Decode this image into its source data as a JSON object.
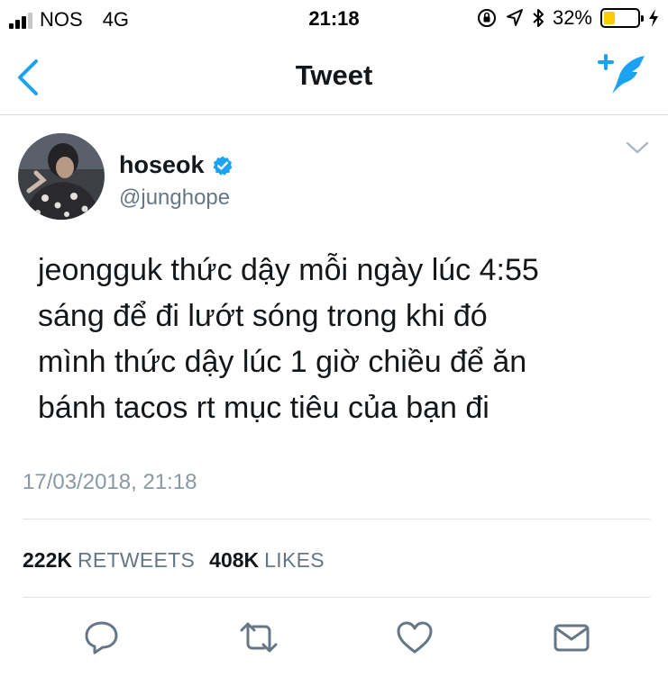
{
  "status_bar": {
    "carrier": "NOS",
    "network": "4G",
    "time": "21:18",
    "battery_percent": "32%",
    "battery_level": 0.32,
    "signal_bars_filled": 3,
    "signal_bars_total": 4,
    "icons": [
      "orientation-lock-icon",
      "location-arrow-icon",
      "bluetooth-icon",
      "battery-icon",
      "charging-bolt-icon"
    ]
  },
  "nav": {
    "title": "Tweet",
    "back_icon": "chevron-left-icon",
    "compose_icon": "compose-tweet-icon"
  },
  "tweet": {
    "display_name": "hoseok",
    "verified": true,
    "handle": "@junghope",
    "lines": [
      "jeongguk thức dậy mỗi ngày lúc 4:55",
      "sáng để đi lướt sóng trong khi đó",
      "mình thức dậy lúc 1 giờ chiều để ăn",
      "bánh tacos rt mục tiêu của bạn đi"
    ],
    "timestamp": "17/03/2018, 21:18"
  },
  "stats": {
    "retweets_count": "222K",
    "retweets_label": "RETWEETS",
    "likes_count": "408K",
    "likes_label": "LIKES"
  },
  "actions": [
    "reply-icon",
    "retweet-icon",
    "like-icon",
    "direct-message-icon"
  ],
  "colors": {
    "accent": "#1da1f2",
    "text_primary": "#14171a",
    "text_secondary": "#657786",
    "battery_fill": "#ffcc00"
  }
}
